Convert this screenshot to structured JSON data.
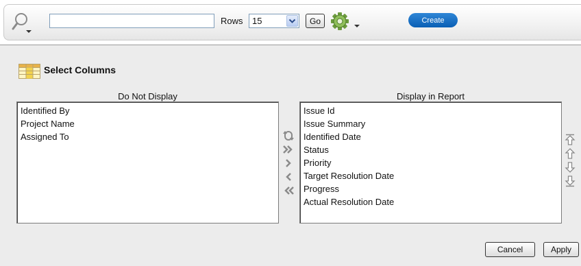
{
  "search": {
    "value": "",
    "placeholder": ""
  },
  "rows": {
    "label": "Rows",
    "value": "15"
  },
  "toolbar": {
    "go_label": "Go",
    "create_label": "Create"
  },
  "panel": {
    "title": "Select Columns",
    "do_not_display": {
      "heading": "Do Not Display",
      "items": [
        "Identified By",
        "Project Name",
        "Assigned To"
      ]
    },
    "display_in_report": {
      "heading": "Display in Report",
      "items": [
        "Issue Id",
        "Issue Summary",
        "Identified Date",
        "Status",
        "Priority",
        "Target Resolution Date",
        "Progress",
        "Actual Resolution Date"
      ]
    },
    "cancel_label": "Cancel",
    "apply_label": "Apply"
  },
  "colors": {
    "create_button": "#0a6fc7",
    "panel_bg": "#ececec",
    "arrow": "#8a8a8a"
  },
  "icons": {
    "search": "magnifier-icon",
    "actions": "gear-icon",
    "table": "table-grid-icon",
    "movers": [
      "reset-icon",
      "move-all-right-icon",
      "move-right-icon",
      "move-left-icon",
      "move-all-left-icon"
    ],
    "order": [
      "move-top-icon",
      "move-up-icon",
      "move-down-icon",
      "move-bottom-icon"
    ]
  }
}
